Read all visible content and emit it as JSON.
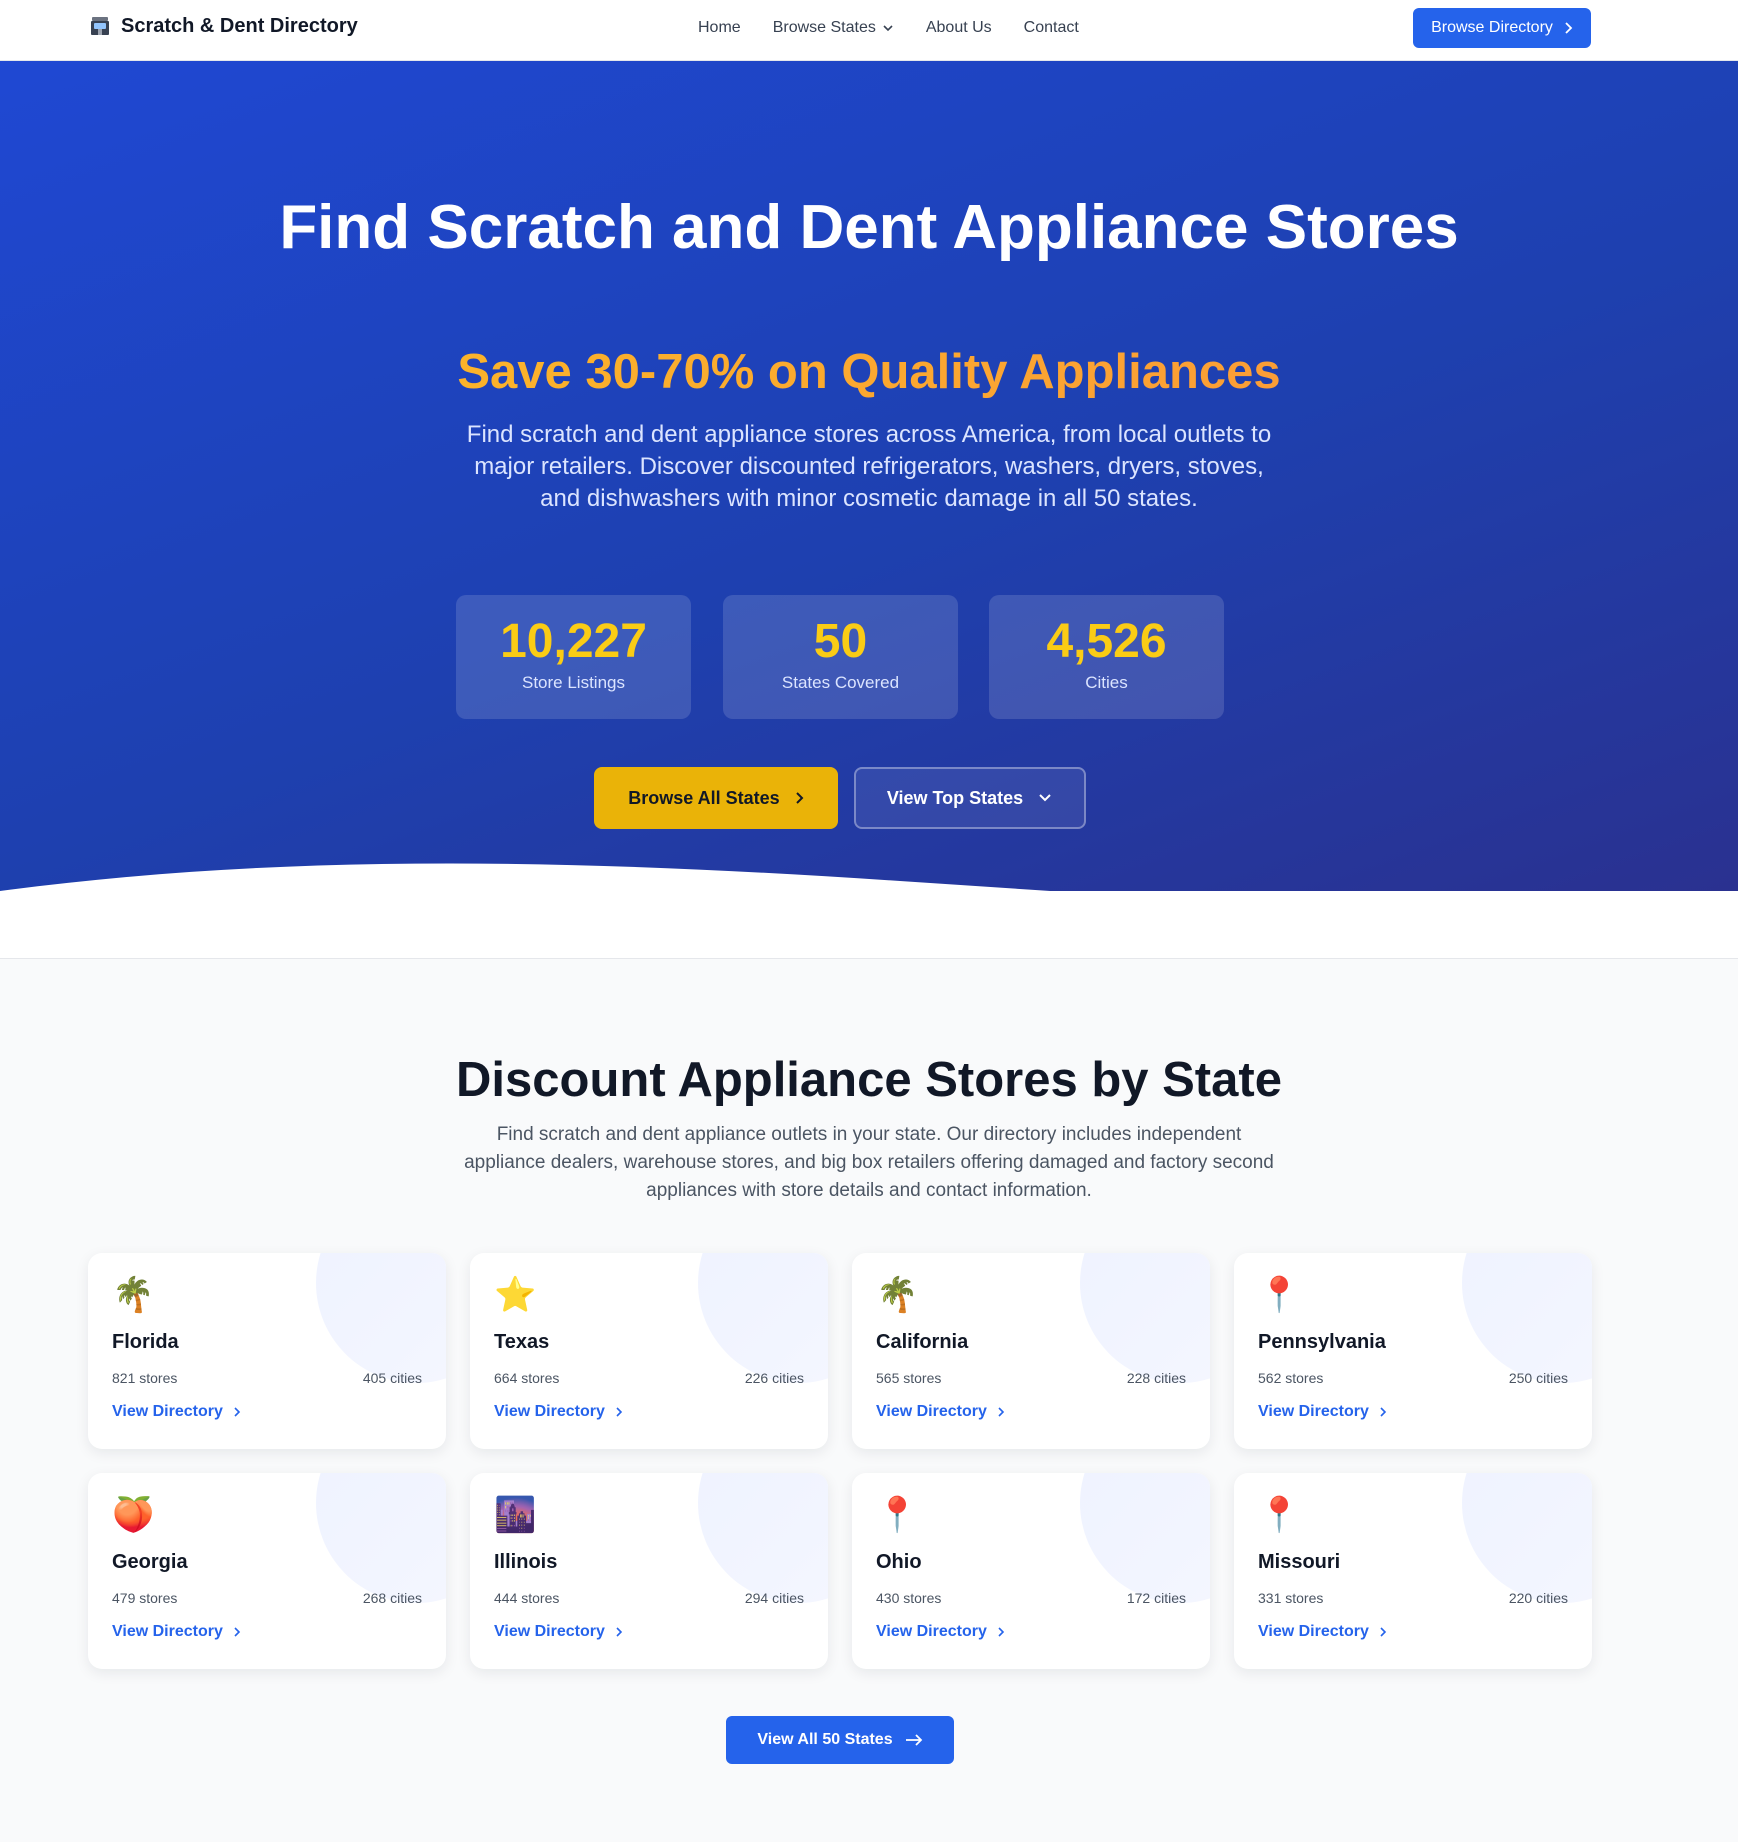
{
  "nav": {
    "brand": "Scratch & Dent Directory",
    "links": [
      "Home",
      "Browse States",
      "About Us",
      "Contact"
    ],
    "cta": "Browse Directory"
  },
  "hero": {
    "title": "Find Scratch and Dent Appliance Stores",
    "subtitle": "Save 30-70% on Quality Appliances",
    "description": "Find scratch and dent appliance stores across America, from local outlets to major retailers. Discover discounted refrigerators, washers, dryers, stoves, and dishwashers with minor cosmetic damage in all 50 states.",
    "stats": [
      {
        "value": "10,227",
        "label": "Store Listings"
      },
      {
        "value": "50",
        "label": "States Covered"
      },
      {
        "value": "4,526",
        "label": "Cities"
      }
    ],
    "primary_button": "Browse All States",
    "secondary_button": "View Top States"
  },
  "states_section": {
    "title": "Discount Appliance Stores by State",
    "description": "Find scratch and dent appliance outlets in your state. Our directory includes independent appliance dealers, warehouse stores, and big box retailers offering damaged and factory second appliances with store details and contact information.",
    "cards": [
      {
        "icon": "🌴",
        "icon_name": "palm-tree-icon",
        "name": "Florida",
        "stores": "821 stores",
        "cities": "405 cities",
        "link": "View Directory"
      },
      {
        "icon": "⭐",
        "icon_name": "star-icon",
        "name": "Texas",
        "stores": "664 stores",
        "cities": "226 cities",
        "link": "View Directory"
      },
      {
        "icon": "🌴",
        "icon_name": "palm-tree-icon",
        "name": "California",
        "stores": "565 stores",
        "cities": "228 cities",
        "link": "View Directory"
      },
      {
        "icon": "📍",
        "icon_name": "map-pin-icon",
        "name": "Pennsylvania",
        "stores": "562 stores",
        "cities": "250 cities",
        "link": "View Directory"
      },
      {
        "icon": "🍑",
        "icon_name": "peach-icon",
        "name": "Georgia",
        "stores": "479 stores",
        "cities": "268 cities",
        "link": "View Directory"
      },
      {
        "icon": "🌆",
        "icon_name": "city-icon",
        "name": "Illinois",
        "stores": "444 stores",
        "cities": "294 cities",
        "link": "View Directory"
      },
      {
        "icon": "📍",
        "icon_name": "map-pin-icon",
        "name": "Ohio",
        "stores": "430 stores",
        "cities": "172 cities",
        "link": "View Directory"
      },
      {
        "icon": "📍",
        "icon_name": "map-pin-icon",
        "name": "Missouri",
        "stores": "331 stores",
        "cities": "220 cities",
        "link": "View Directory"
      }
    ],
    "view_all": "View All 50 States"
  },
  "colors": {
    "primary": "#2563eb",
    "accent_yellow": "#eab308",
    "stat_yellow": "#facc15",
    "hero_gradient_start": "#1f48d3",
    "hero_gradient_end": "#2a3190"
  }
}
